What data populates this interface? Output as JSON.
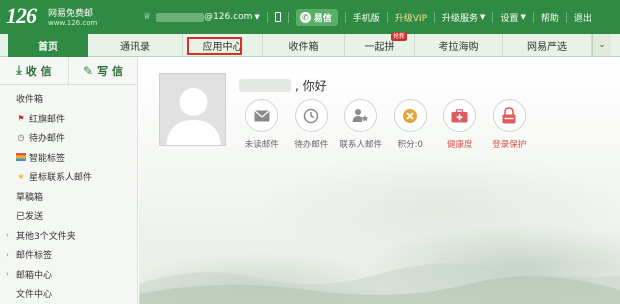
{
  "header": {
    "logo_number": "126",
    "logo_name": "网易免费邮",
    "logo_url": "www.126.com",
    "account_suffix": "@126.com",
    "nav": {
      "yixin": "易信",
      "mobile": "手机版",
      "upgrade_vip": "升级VIP",
      "upgrade_service": "升级服务",
      "settings": "设置",
      "help": "帮助",
      "logout": "退出"
    }
  },
  "tabs": [
    {
      "label": "首页",
      "active": true
    },
    {
      "label": "通讯录"
    },
    {
      "label": "应用中心",
      "highlighted": true
    },
    {
      "label": "收件箱"
    },
    {
      "label": "一起拼",
      "badge": "抢新"
    },
    {
      "label": "考拉海购"
    },
    {
      "label": "网易严选"
    }
  ],
  "sidebar": {
    "receive_label": "收 信",
    "compose_label": "写 信",
    "folders": [
      {
        "label": "收件箱"
      },
      {
        "label": "红旗邮件",
        "icon": "red-flag-icon"
      },
      {
        "label": "待办邮件",
        "icon": "clock-icon"
      },
      {
        "label": "智能标签",
        "icon": "tag-bars-icon"
      },
      {
        "label": "星标联系人邮件",
        "icon": "star-icon"
      },
      {
        "label": "草稿箱"
      },
      {
        "label": "已发送"
      },
      {
        "label": "其他3个文件夹",
        "expandable": true
      },
      {
        "label": "邮件标签",
        "expandable": true
      },
      {
        "label": "邮箱中心",
        "expandable": true
      },
      {
        "label": "文件中心"
      }
    ]
  },
  "main": {
    "greeting": ", 你好",
    "quick_links": [
      {
        "label": "未读邮件",
        "icon": "envelope-icon",
        "color": "#8a8a8a"
      },
      {
        "label": "待办邮件",
        "icon": "clock-icon",
        "color": "#8a8a8a"
      },
      {
        "label": "联系人邮件",
        "icon": "contact-star-icon",
        "color": "#8a8a8a"
      },
      {
        "label": "积分:0",
        "icon": "points-icon",
        "color": "#e8a23c"
      },
      {
        "label": "健康度",
        "icon": "medkit-icon",
        "color": "#e05b5b"
      },
      {
        "label": "登录保护",
        "icon": "lock-icon",
        "color": "#e05b5b"
      }
    ]
  },
  "colors": {
    "brand_green": "#2f8a43",
    "tab_bar": "#e9f2e7",
    "highlight_box": "#d9302b",
    "vip_text": "#f6e28a"
  }
}
